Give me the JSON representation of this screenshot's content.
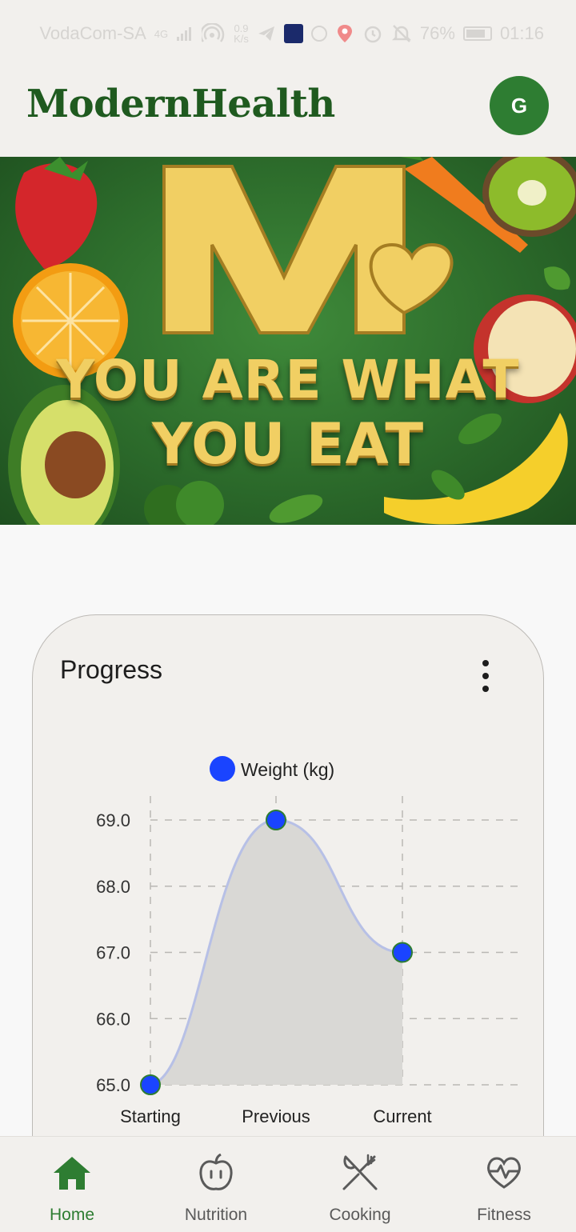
{
  "status_bar": {
    "carrier": "VodaCom-SA",
    "network": "4G",
    "speed_value": "0.9",
    "speed_unit": "K/s",
    "battery": "76%",
    "time": "01:16"
  },
  "header": {
    "title": "ModernHealth",
    "avatar_initial": "G"
  },
  "banner": {
    "line1": "YOU ARE WHAT",
    "line2": "YOU EAT",
    "logo_letter": "M"
  },
  "theme_toggle": {
    "icon": "moon-icon"
  },
  "progress_card": {
    "title": "Progress",
    "menu_icon": "more-vert-icon"
  },
  "chart_data": {
    "type": "line",
    "categories": [
      "Starting",
      "Previous",
      "Current"
    ],
    "series": [
      {
        "name": "Weight (kg)",
        "values": [
          65.0,
          69.0,
          67.0
        ]
      }
    ],
    "y_ticks": [
      "65.0",
      "66.0",
      "67.0",
      "68.0",
      "69.0"
    ],
    "ylim": [
      65,
      69
    ],
    "grid": true,
    "legend_position": "top",
    "colors": {
      "point": "#1a44ff",
      "point_border": "#2e7d32",
      "line": "#b7c0e6",
      "fill": "#d9d8d5"
    }
  },
  "bottom_nav": {
    "items": [
      {
        "label": "Home",
        "icon": "home-icon",
        "active": true
      },
      {
        "label": "Nutrition",
        "icon": "apple-icon",
        "active": false
      },
      {
        "label": "Cooking",
        "icon": "fork-knife-icon",
        "active": false
      },
      {
        "label": "Fitness",
        "icon": "heart-pulse-icon",
        "active": false
      }
    ]
  },
  "colors": {
    "brand": "#1f5a1f",
    "accent": "#2e7d32",
    "surface": "#f2f0ed",
    "background": "#f8f8f8"
  }
}
